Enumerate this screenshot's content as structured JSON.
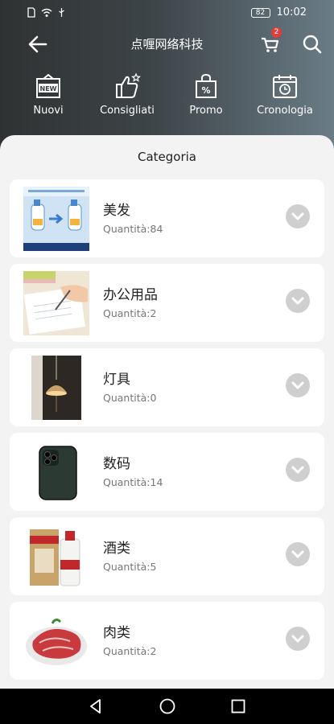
{
  "status_bar": {
    "battery": "82",
    "time": "10:02"
  },
  "header": {
    "title": "点喱网络科技",
    "cart_count": "2"
  },
  "quick_nav": [
    {
      "label": "Nuovi",
      "icon": "new-icon"
    },
    {
      "label": "Consigliati",
      "icon": "thumbs-up-icon"
    },
    {
      "label": "Promo",
      "icon": "promo-bag-icon"
    },
    {
      "label": "Cronologia",
      "icon": "history-calendar-icon"
    }
  ],
  "section_title": "Categoria",
  "categories": [
    {
      "name": "美发",
      "qty": "Quantità:84"
    },
    {
      "name": "办公用品",
      "qty": "Quantità:2"
    },
    {
      "name": "灯具",
      "qty": "Quantità:0"
    },
    {
      "name": "数码",
      "qty": "Quantità:14"
    },
    {
      "name": "酒类",
      "qty": "Quantità:5"
    },
    {
      "name": "肉类",
      "qty": "Quantità:2"
    }
  ],
  "colors": {
    "header_start": "#2f3233",
    "header_end": "#6a7c86",
    "badge": "#e23c3c",
    "chevron_bg": "#cfcfcf"
  }
}
